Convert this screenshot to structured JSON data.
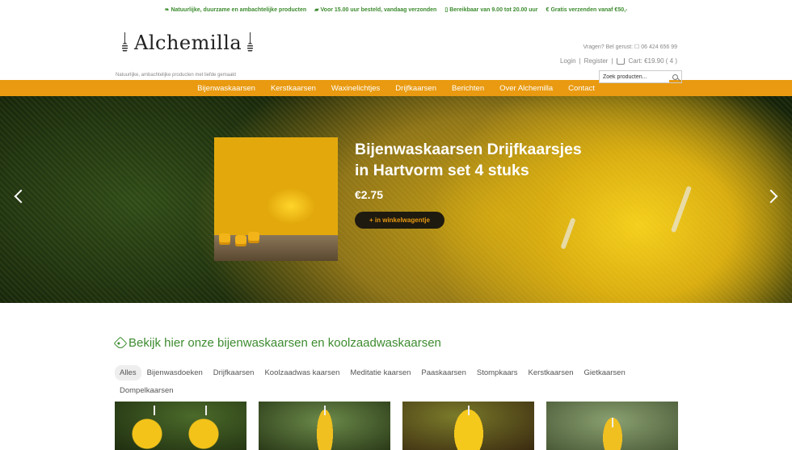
{
  "usps": [
    {
      "icon": "leaf-icon",
      "text": "Natuurlijke, duurzame en ambachtelijke producten"
    },
    {
      "icon": "truck-icon",
      "text": "Voor 15.00 uur besteld, vandaag verzonden"
    },
    {
      "icon": "phone-icon",
      "text": "Bereikbaar van 9.00 tot 20.00 uur"
    },
    {
      "icon": "euro-icon",
      "text": "Gratis verzenden vanaf €50,-"
    }
  ],
  "brand": {
    "name": "Alchemilla",
    "tagline": "Natuurlijke, ambachtelijke producten met liefde gemaakt"
  },
  "header": {
    "phone_text": "Vragen? Bel gerust: ☐ 06 424 656 99",
    "login": "Login",
    "register": "Register",
    "cart": "Cart: €19.90 ( 4 )",
    "search_placeholder": "Zoek producten..."
  },
  "nav": [
    "Bijenwaskaarsen",
    "Kerstkaarsen",
    "Waxinelichtjes",
    "Drijfkaarsen",
    "Berichten",
    "Over Alchemilla",
    "Contact"
  ],
  "hero": {
    "title_line1": "Bijenwaskaarsen Drijfkaarsjes",
    "title_line2": "in Hartvorm set 4 stuks",
    "price": "€2.75",
    "button": "+ in winkelwagentje"
  },
  "products_section": {
    "title": "Bekijk hier onze bijenwaskaarsen en koolzaadwaskaarsen",
    "filters": [
      "Alles",
      "Bijenwasdoeken",
      "Drijfkaarsen",
      "Koolzaadwas kaarsen",
      "Meditatie kaarsen",
      "Paaskaarsen",
      "Stompkaars",
      "Kerstkaarsen",
      "Gietkaarsen",
      "Dompelkaarsen"
    ],
    "active_filter": "Alles"
  },
  "colors": {
    "accent": "#e99a10",
    "green": "#3d8b2f"
  }
}
